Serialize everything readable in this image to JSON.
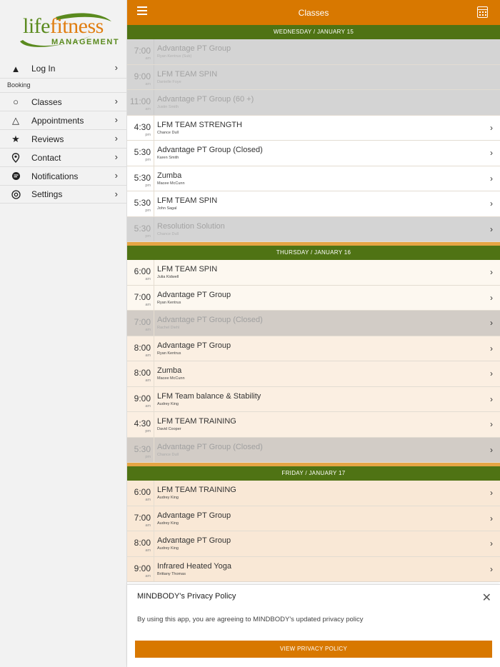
{
  "app": {
    "logo_life": "life",
    "logo_fitness": "fitness",
    "logo_sub": "MANAGEMENT"
  },
  "sidebar": {
    "login": {
      "label": "Log In",
      "icon": "warning-icon"
    },
    "section_label": "Booking",
    "items": [
      {
        "label": "Classes",
        "icon": "circle-icon"
      },
      {
        "label": "Appointments",
        "icon": "triangle-icon"
      },
      {
        "label": "Reviews",
        "icon": "star-icon"
      },
      {
        "label": "Contact",
        "icon": "location-pin-icon"
      },
      {
        "label": "Notifications",
        "icon": "chat-bubble-icon"
      },
      {
        "label": "Settings",
        "icon": "settings-icon"
      }
    ]
  },
  "header": {
    "title": "Classes",
    "menu_icon": "hamburger-menu-icon",
    "calendar_icon": "calendar-icon",
    "color": "#d87800"
  },
  "days": [
    {
      "label": "WEDNESDAY / JANUARY 15",
      "classes": [
        {
          "time": "7:00",
          "ampm": "am",
          "name": "Advantage PT Group",
          "instructor": "Ryan Kentrus (Sub)",
          "state": "disabled"
        },
        {
          "time": "9:00",
          "ampm": "am",
          "name": "LFM TEAM SPIN",
          "instructor": "Danielle Foye",
          "state": "disabled"
        },
        {
          "time": "11:00",
          "ampm": "am",
          "name": "Advantage PT Group (60 +)",
          "instructor": "Justin Smith",
          "state": "disabled"
        },
        {
          "time": "4:30",
          "ampm": "pm",
          "name": "LFM TEAM STRENGTH",
          "instructor": "Chance Dull",
          "state": "available"
        },
        {
          "time": "5:30",
          "ampm": "pm",
          "name": "Advantage PT Group (Closed)",
          "instructor": "Karen Smith",
          "state": "available"
        },
        {
          "time": "5:30",
          "ampm": "pm",
          "name": "Zumba",
          "instructor": "Macee McCunn",
          "state": "available"
        },
        {
          "time": "5:30",
          "ampm": "pm",
          "name": "LFM TEAM SPIN",
          "instructor": "John Sagal",
          "state": "available"
        },
        {
          "time": "5:30",
          "ampm": "pm",
          "name": "Resolution Solution",
          "instructor": "Chance Dull",
          "state": "greyed"
        }
      ]
    },
    {
      "label": "THURSDAY / JANUARY 16",
      "classes": [
        {
          "time": "6:00",
          "ampm": "am",
          "name": "LFM TEAM SPIN",
          "instructor": "Julia Kidwell",
          "state": "available"
        },
        {
          "time": "7:00",
          "ampm": "am",
          "name": "Advantage PT Group",
          "instructor": "Ryan Kentrus",
          "state": "available"
        },
        {
          "time": "7:00",
          "ampm": "am",
          "name": "Advantage PT Group (Closed)",
          "instructor": "Rachel Diehl",
          "state": "greyed"
        },
        {
          "time": "8:00",
          "ampm": "am",
          "name": "Advantage PT Group",
          "instructor": "Ryan Kentrus",
          "state": "available"
        },
        {
          "time": "8:00",
          "ampm": "am",
          "name": "Zumba",
          "instructor": "Macee McCunn",
          "state": "available"
        },
        {
          "time": "9:00",
          "ampm": "am",
          "name": "LFM Team balance & Stability",
          "instructor": "Audrey King",
          "state": "available"
        },
        {
          "time": "4:30",
          "ampm": "pm",
          "name": "LFM TEAM TRAINING",
          "instructor": "David Cooper",
          "state": "available"
        },
        {
          "time": "5:30",
          "ampm": "pm",
          "name": "Advantage PT Group (Closed)",
          "instructor": "Chance Dull",
          "state": "greyed"
        }
      ]
    },
    {
      "label": "FRIDAY / JANUARY 17",
      "classes": [
        {
          "time": "6:00",
          "ampm": "am",
          "name": "LFM TEAM TRAINING",
          "instructor": "Audrey King",
          "state": "available"
        },
        {
          "time": "7:00",
          "ampm": "am",
          "name": "Advantage PT Group",
          "instructor": "Audrey King",
          "state": "available"
        },
        {
          "time": "8:00",
          "ampm": "am",
          "name": "Advantage PT Group",
          "instructor": "Audrey King",
          "state": "available"
        },
        {
          "time": "9:00",
          "ampm": "am",
          "name": "Infrared Heated Yoga",
          "instructor": "Brittany Thomas",
          "state": "available"
        }
      ]
    }
  ],
  "privacy": {
    "title": "MINDBODY's Privacy Policy",
    "text": "By using this app, you are agreeing to MINDBODY's updated privacy policy",
    "button": "VIEW PRIVACY POLICY",
    "close_icon": "close-icon"
  }
}
